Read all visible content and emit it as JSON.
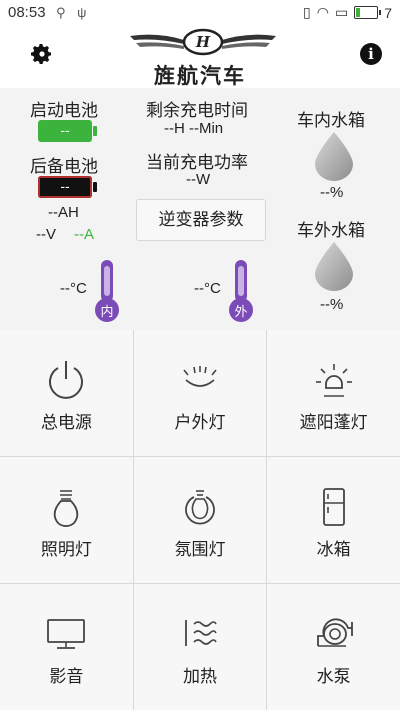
{
  "status_bar": {
    "time": "08:53",
    "battery_percent": "7"
  },
  "header": {
    "app_title": "旌航汽车"
  },
  "panel": {
    "start_battery": {
      "label": "启动电池",
      "value": "--",
      "color": "#3cb33c"
    },
    "backup_battery": {
      "label": "后备电池",
      "value": "--",
      "color": "#111111"
    },
    "capacity": "--AH",
    "voltage": "--V",
    "current": "--A",
    "remaining_time_label": "剩余充电时间",
    "remaining_time_value": "--H --Min",
    "charge_power_label": "当前充电功率",
    "charge_power_value": "--W",
    "inverter_button": "逆变器参数",
    "inner_tank_label": "车内水箱",
    "inner_tank_value": "--%",
    "outer_tank_label": "车外水箱",
    "outer_tank_value": "--%",
    "inner_temp": "--°C",
    "inner_temp_tag": "内",
    "outer_temp": "--°C",
    "outer_temp_tag": "外"
  },
  "grid": [
    {
      "label": "总电源",
      "icon": "power-icon"
    },
    {
      "label": "户外灯",
      "icon": "outdoor-light-icon"
    },
    {
      "label": "遮阳蓬灯",
      "icon": "awning-light-icon"
    },
    {
      "label": "照明灯",
      "icon": "bulb-icon"
    },
    {
      "label": "氛围灯",
      "icon": "ambient-light-icon"
    },
    {
      "label": "冰箱",
      "icon": "fridge-icon"
    },
    {
      "label": "影音",
      "icon": "monitor-icon"
    },
    {
      "label": "加热",
      "icon": "heater-icon"
    },
    {
      "label": "水泵",
      "icon": "water-pump-icon"
    }
  ]
}
